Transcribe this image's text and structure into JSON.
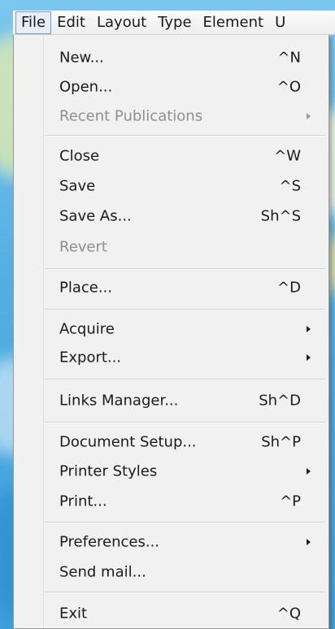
{
  "menubar": {
    "items": [
      {
        "label": "File"
      },
      {
        "label": "Edit"
      },
      {
        "label": "Layout"
      },
      {
        "label": "Type"
      },
      {
        "label": "Element"
      },
      {
        "label": "U"
      }
    ]
  },
  "file_menu": {
    "items": [
      {
        "label": "New...",
        "shortcut": "^N"
      },
      {
        "label": "Open...",
        "shortcut": "^O"
      },
      {
        "label": "Recent Publications",
        "submenu": true,
        "disabled": true
      },
      {
        "label": "Close",
        "shortcut": "^W"
      },
      {
        "label": "Save",
        "shortcut": "^S"
      },
      {
        "label": "Save As...",
        "shortcut": "Sh^S"
      },
      {
        "label": "Revert",
        "disabled": true
      },
      {
        "label": "Place...",
        "shortcut": "^D"
      },
      {
        "label": "Acquire",
        "submenu": true
      },
      {
        "label": "Export...",
        "submenu": true
      },
      {
        "label": "Links Manager...",
        "shortcut": "Sh^D"
      },
      {
        "label": "Document Setup...",
        "shortcut": "Sh^P"
      },
      {
        "label": "Printer Styles",
        "submenu": true
      },
      {
        "label": "Print...",
        "shortcut": "^P"
      },
      {
        "label": "Preferences...",
        "submenu": true
      },
      {
        "label": "Send mail..."
      },
      {
        "label": "Exit",
        "shortcut": "^Q"
      }
    ]
  }
}
